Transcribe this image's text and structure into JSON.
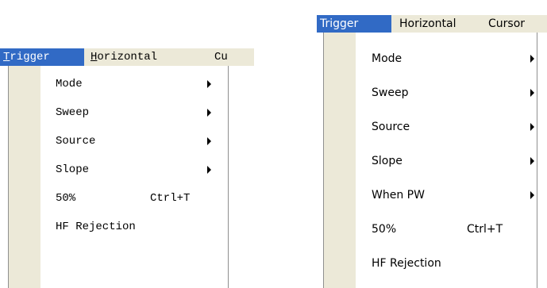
{
  "left": {
    "menubar": {
      "items": [
        {
          "label": "Trigger",
          "mnemonic": "T"
        },
        {
          "label": "Horizontal",
          "mnemonic": "H"
        },
        {
          "label": "Cu"
        }
      ]
    },
    "menu": {
      "items": [
        {
          "label": "Mode",
          "shortcut": "",
          "submenu": true
        },
        {
          "label": "Sweep",
          "shortcut": "",
          "submenu": true
        },
        {
          "label": "Source",
          "shortcut": "",
          "submenu": true
        },
        {
          "label": "Slope",
          "shortcut": "",
          "submenu": true
        },
        {
          "label": "50%",
          "shortcut": "Ctrl+T",
          "submenu": false
        },
        {
          "label": "HF Rejection",
          "shortcut": "",
          "submenu": false
        }
      ]
    }
  },
  "right": {
    "menubar": {
      "items": [
        {
          "label": "Trigger"
        },
        {
          "label": "Horizontal"
        },
        {
          "label": "Cursor"
        }
      ]
    },
    "menu": {
      "items": [
        {
          "label": "Mode",
          "shortcut": "",
          "submenu": true
        },
        {
          "label": "Sweep",
          "shortcut": "",
          "submenu": true
        },
        {
          "label": "Source",
          "shortcut": "",
          "submenu": true
        },
        {
          "label": "Slope",
          "shortcut": "",
          "submenu": true
        },
        {
          "label": "When PW",
          "shortcut": "",
          "submenu": true
        },
        {
          "label": "50%",
          "shortcut": "Ctrl+T",
          "submenu": false
        },
        {
          "label": "HF Rejection",
          "shortcut": "",
          "submenu": false
        }
      ]
    }
  },
  "colors": {
    "menubar_bg": "#ece9d8",
    "highlight_bg": "#316ac5",
    "highlight_fg": "#ffffff",
    "menu_bg": "#ffffff",
    "gutter": "#ece9d8"
  }
}
